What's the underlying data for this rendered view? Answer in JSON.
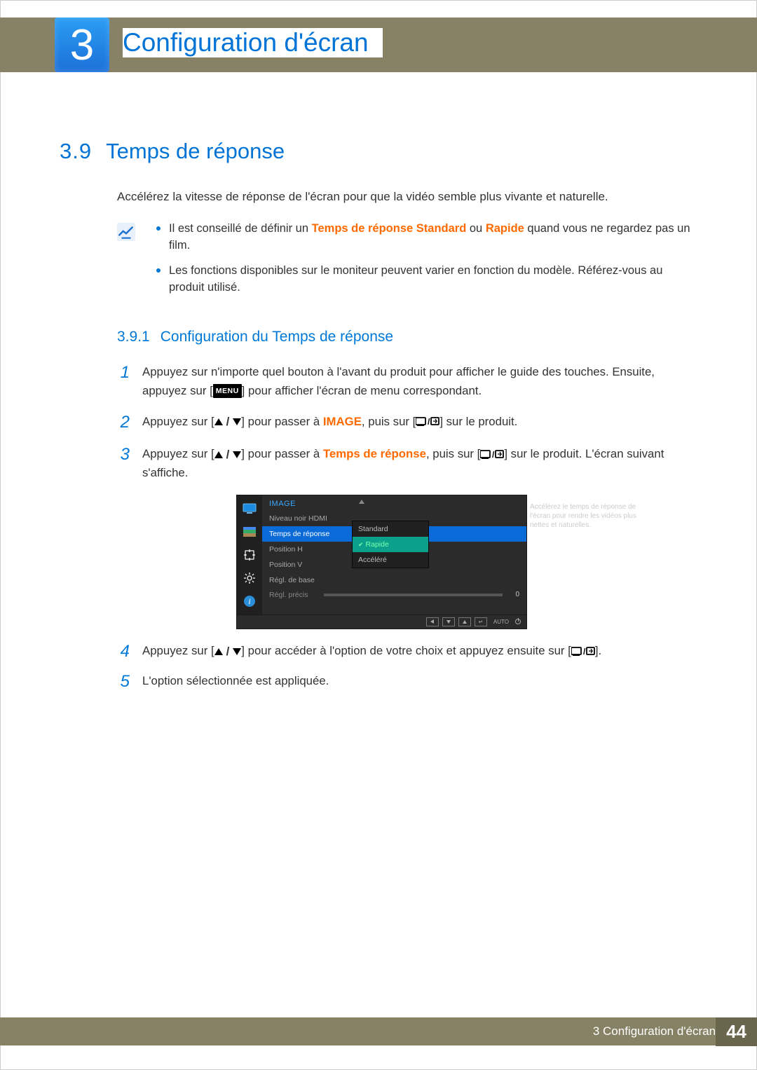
{
  "chapter": {
    "badge_number": "3",
    "title": "Configuration d'écran"
  },
  "section": {
    "number": "3.9",
    "title": "Temps de réponse",
    "intro": "Accélérez la vitesse de réponse de l'écran pour que la vidéo semble plus vivante et naturelle."
  },
  "notes": {
    "item1_prefix": "Il est conseillé de définir un ",
    "item1_bold1": "Temps de réponse Standard",
    "item1_mid": " ou ",
    "item1_bold2": "Rapide",
    "item1_suffix": " quand vous ne regardez pas un film.",
    "item2": "Les fonctions disponibles sur le moniteur peuvent varier en fonction du modèle. Référez-vous au produit utilisé."
  },
  "subsection": {
    "number": "3.9.1",
    "title": "Configuration du Temps de réponse"
  },
  "steps": {
    "s1_a": "Appuyez sur n'importe quel bouton à l'avant du produit pour afficher le guide des touches. Ensuite, appuyez sur [",
    "s1_menu": "MENU",
    "s1_b": "] pour afficher l'écran de menu correspondant.",
    "s2_a": "Appuyez sur [",
    "s2_b": "] pour passer à ",
    "s2_image": "IMAGE",
    "s2_c": ", puis sur [",
    "s2_d": "] sur le produit.",
    "s3_a": "Appuyez sur [",
    "s3_b": "] pour passer à ",
    "s3_temps": "Temps de réponse",
    "s3_c": ", puis sur [",
    "s3_d": "] sur le produit. L'écran suivant s'affiche.",
    "s4_a": "Appuyez sur [",
    "s4_b": "] pour accéder à l'option de votre choix et appuyez ensuite sur [",
    "s4_c": "].",
    "s5": "L'option sélectionnée est appliquée."
  },
  "osd": {
    "category": "IMAGE",
    "items": {
      "hdmi_black": "Niveau noir HDMI",
      "response": "Temps de réponse",
      "pos_h": "Position H",
      "pos_v": "Position V",
      "coarse": "Régl. de base",
      "fine": "Régl. précis"
    },
    "options": {
      "standard": "Standard",
      "rapide": "Rapide",
      "accelere": "Accéléré"
    },
    "slider_value": "0",
    "tooltip": "Accélérez le temps de réponse de l'écran pour rendre les vidéos plus nettes et naturelles.",
    "nav_auto": "AUTO"
  },
  "footer": {
    "label": "3 Configuration d'écran",
    "page": "44"
  }
}
